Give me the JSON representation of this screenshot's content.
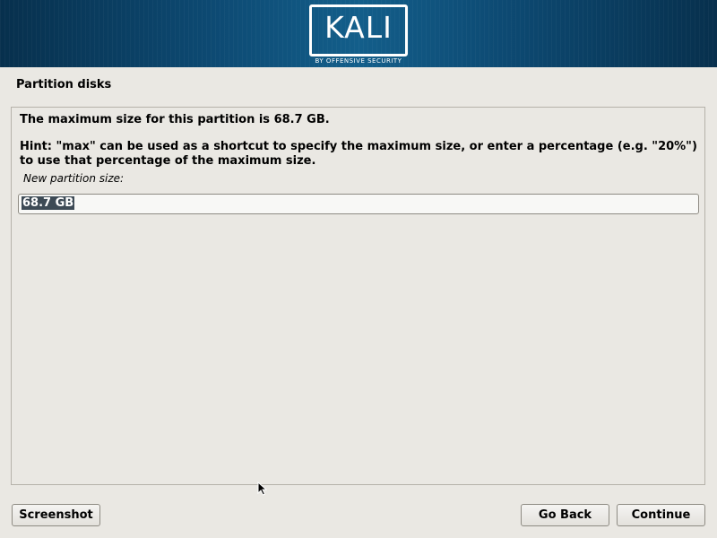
{
  "banner": {
    "logo_text": "KALI",
    "logo_subtitle": "BY OFFENSIVE SECURITY"
  },
  "page": {
    "title": "Partition disks"
  },
  "main": {
    "max_size_message": "The maximum size for this partition is 68.7 GB.",
    "hint_message": "Hint: \"max\" can be used as a shortcut to specify the maximum size, or enter a percentage (e.g. \"20%\") to use that percentage of the maximum size.",
    "field_label": "New partition size:",
    "field_value": "68.7 GB"
  },
  "buttons": {
    "screenshot": "Screenshot",
    "go_back": "Go Back",
    "continue": "Continue"
  },
  "colors": {
    "banner_dark": "#07304d",
    "banner_light": "#135e8a",
    "background": "#eae8e3",
    "selection": "#3d4a55"
  }
}
